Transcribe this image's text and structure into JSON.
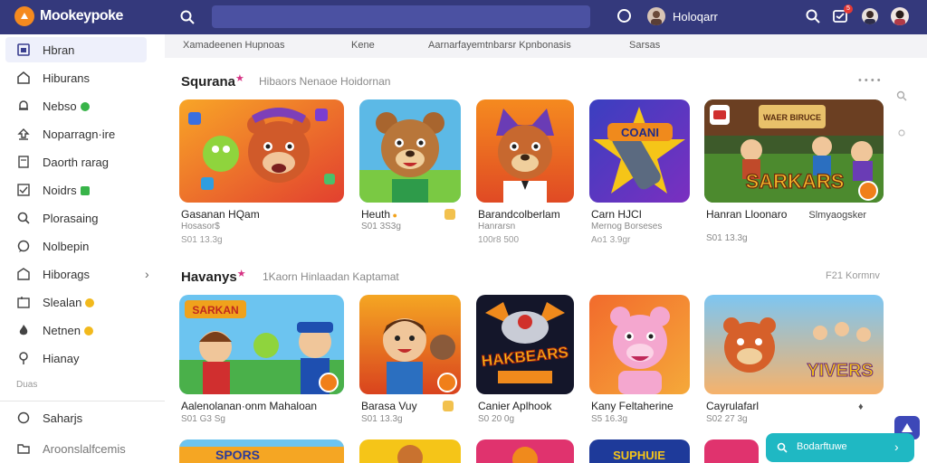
{
  "app": {
    "logo_text": "Mookeypoke",
    "user_name": "Holoqarr",
    "notification_count": "5"
  },
  "search": {
    "placeholder": ""
  },
  "colors": {
    "topbar": "#34397c",
    "accent": "#f58a1f",
    "chat": "#1fb8c3"
  },
  "sidebar": {
    "items": [
      {
        "label": "Hbran",
        "icon": "home-icon",
        "active": true
      },
      {
        "label": "Hiburans",
        "icon": "building-icon"
      },
      {
        "label": "Nebso",
        "icon": "bell-icon",
        "badge": "green"
      },
      {
        "label": "Noparragn·ire",
        "icon": "upload-icon"
      },
      {
        "label": "Daorth rarag",
        "icon": "document-icon"
      },
      {
        "label": "Noidrs",
        "icon": "checklist-icon",
        "badge": "green-square"
      },
      {
        "label": "Plorasaing",
        "icon": "search-icon"
      },
      {
        "label": "Nolbepin",
        "icon": "chat-icon"
      },
      {
        "label": "Hiborags",
        "icon": "library-icon",
        "chevron": "›"
      },
      {
        "label": "Slealan",
        "icon": "tag-icon",
        "badge": "yellow"
      },
      {
        "label": "Netnen",
        "icon": "flame-icon",
        "badge": "yellow"
      },
      {
        "label": "Hianay",
        "icon": "pin-icon"
      }
    ],
    "section_label": "Duas",
    "bottom_items": [
      {
        "label": "Saharjs",
        "icon": "circle-icon"
      },
      {
        "label": "Aroonslalfcemis",
        "icon": "folder-icon"
      }
    ]
  },
  "tabs": [
    "Xamadeenen Hupnoas",
    "Kene",
    "Aarnarfayemtnbarsr Kpnbonasis",
    "Sarsas"
  ],
  "sections": [
    {
      "title": "Squrana",
      "subtitle": "Hibaors Nenaoe Hoidornan",
      "more": "• • • •",
      "cards": [
        {
          "title": "Gasanan HQam",
          "meta": "Hosasor$",
          "meta2": "S01 13.3g",
          "art": "bear-candy"
        },
        {
          "title": "Heuth",
          "meta": "S01 3S3g",
          "meta2": "",
          "art": "bear-green"
        },
        {
          "title": "Barandcolberlam",
          "meta": "Hanrarsn",
          "meta2": "100r8 500",
          "art": "bear-purple"
        },
        {
          "title": "Carn HJCI",
          "meta": "Mernog Borseses",
          "meta2": "Ao1 3.9gr",
          "art": "rocket"
        },
        {
          "title": "Hanran Lloonaro",
          "meta": "S01 13.3g",
          "meta2": "",
          "side": "Slmyaogsker",
          "art": "sarkars"
        }
      ]
    },
    {
      "title": "Havanys",
      "subtitle": "1Kaorn Hinlaadan Kaptamat",
      "more": "F21 Kormnv",
      "cards": [
        {
          "title": "Aalenolanan·onm Mahaloan",
          "meta": "S01 G3 Sg",
          "meta2": "",
          "art": "kids"
        },
        {
          "title": "Barasa Vuy",
          "meta": "S01 13.3g",
          "meta2": "",
          "art": "boy"
        },
        {
          "title": "Canier Aplhook",
          "meta": "S0 20 0g",
          "meta2": "",
          "art": "hakbears"
        },
        {
          "title": "Kany Feltaherine",
          "meta": "S5 16.3g",
          "meta2": "",
          "art": "pink-bear"
        },
        {
          "title": "Cayrulafarl",
          "meta": "S02 27 3g",
          "meta2": "",
          "art": "yivers"
        }
      ]
    }
  ],
  "thumb_texts": {
    "rocket": "COANI",
    "sarkars": "SARKARS",
    "sarkars_sign": "WAER BIRUCE",
    "kids": "SARKAN",
    "hakbears": "HAKBEARS",
    "yivers": "YIVERS"
  },
  "third_row_texts": [
    "SPORS",
    "SUPHUIE"
  ],
  "chat": {
    "label": "Bodarftuwe",
    "chevron": "›"
  }
}
